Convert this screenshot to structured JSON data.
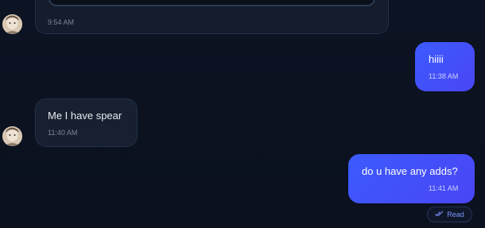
{
  "messages": [
    {
      "side": "incoming",
      "text": "",
      "time": "9:54 AM"
    },
    {
      "side": "outgoing",
      "text": "hiiii",
      "time": "11:38 AM"
    },
    {
      "side": "incoming",
      "text": "Me I have spear",
      "time": "11:40 AM"
    },
    {
      "side": "outgoing",
      "text": "do u have any adds?",
      "time": "11:41 AM"
    }
  ],
  "read_receipt": {
    "icon": "double-check-icon",
    "label": "Read"
  },
  "colors": {
    "background": "#0c1220",
    "incoming_bubble": "#162030",
    "outgoing_bubble": "#3b5bfd",
    "read_accent": "#7e95ff"
  }
}
